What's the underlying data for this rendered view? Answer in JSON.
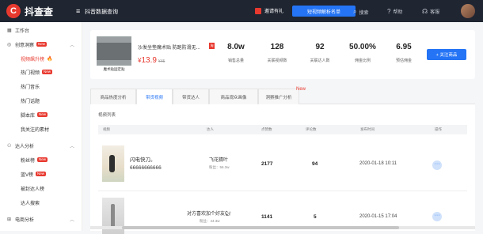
{
  "brand": {
    "logo_glyph": "C",
    "name": "抖查查",
    "accent": "#e8392f"
  },
  "header": {
    "menu_icon": "menu-icon",
    "page_name": "抖音数据查询",
    "gift_label": "邀请有礼",
    "download_label": "短视频解析名单",
    "search_label": "搜索",
    "help_label": "帮助",
    "service_label": "客服"
  },
  "sidebar": {
    "items": [
      {
        "label": "工作台",
        "icon": "dashboard-icon"
      },
      {
        "label": "创意洞察",
        "badge": "New",
        "icon": "lightbulb-icon"
      },
      {
        "label": "视频飙升榜",
        "icon": "",
        "fire": true
      },
      {
        "label": "热门视频",
        "badge": "New"
      },
      {
        "label": "热门音乐"
      },
      {
        "label": "热门话题"
      },
      {
        "label": "脚本库",
        "badge": "New"
      },
      {
        "label": "我关注的素材"
      },
      {
        "label": "达人分析",
        "icon": "user-icon"
      },
      {
        "label": "粉丝榜",
        "badge": "New"
      },
      {
        "label": "蓝V榜",
        "badge": "New"
      },
      {
        "label": "被封达人榜"
      },
      {
        "label": "达人搜索"
      },
      {
        "label": "电商分析",
        "icon": "cart-icon"
      }
    ]
  },
  "product": {
    "image_label": "魔术贴固定贴",
    "title": "沙发坐垫魔术贴 防跑防滑无...",
    "tb_badge": "淘",
    "price_symbol": "¥",
    "price": "13.9",
    "old_price": "¥45",
    "stats": [
      {
        "value": "8.0w",
        "label": "销售总量"
      },
      {
        "value": "128",
        "label": "关联视频数"
      },
      {
        "value": "92",
        "label": "关联达人数"
      },
      {
        "value": "50.00%",
        "label": "佣金比例"
      },
      {
        "value": "6.95",
        "label": "预估佣金"
      }
    ],
    "follow_label": "+ 关注商品"
  },
  "tabs": {
    "items": [
      "商品热度分析",
      "带货视频",
      "带货达人",
      "商品观众画像",
      "洞察推广分析"
    ],
    "new_tag": "New",
    "active_index": 1
  },
  "video_list": {
    "section_title": "视频列表",
    "columns": [
      "视频",
      "达人",
      "点赞数",
      "评论数",
      "发布时间",
      "操作"
    ],
    "rows": [
      {
        "title": "闪电快刀。66666666666",
        "daren": "飞花猜叶",
        "fans": "粉丝：56.3w",
        "likes": "2177",
        "comments": "94",
        "time": "2020-01-18 10:11",
        "op": "···"
      },
      {
        "title": "",
        "daren": "对方喜欢加个好友🐿",
        "fans": "粉丝：44.3w",
        "likes": "1141",
        "comments": "5",
        "time": "2020-01-15 17:04",
        "op": "···"
      }
    ]
  }
}
